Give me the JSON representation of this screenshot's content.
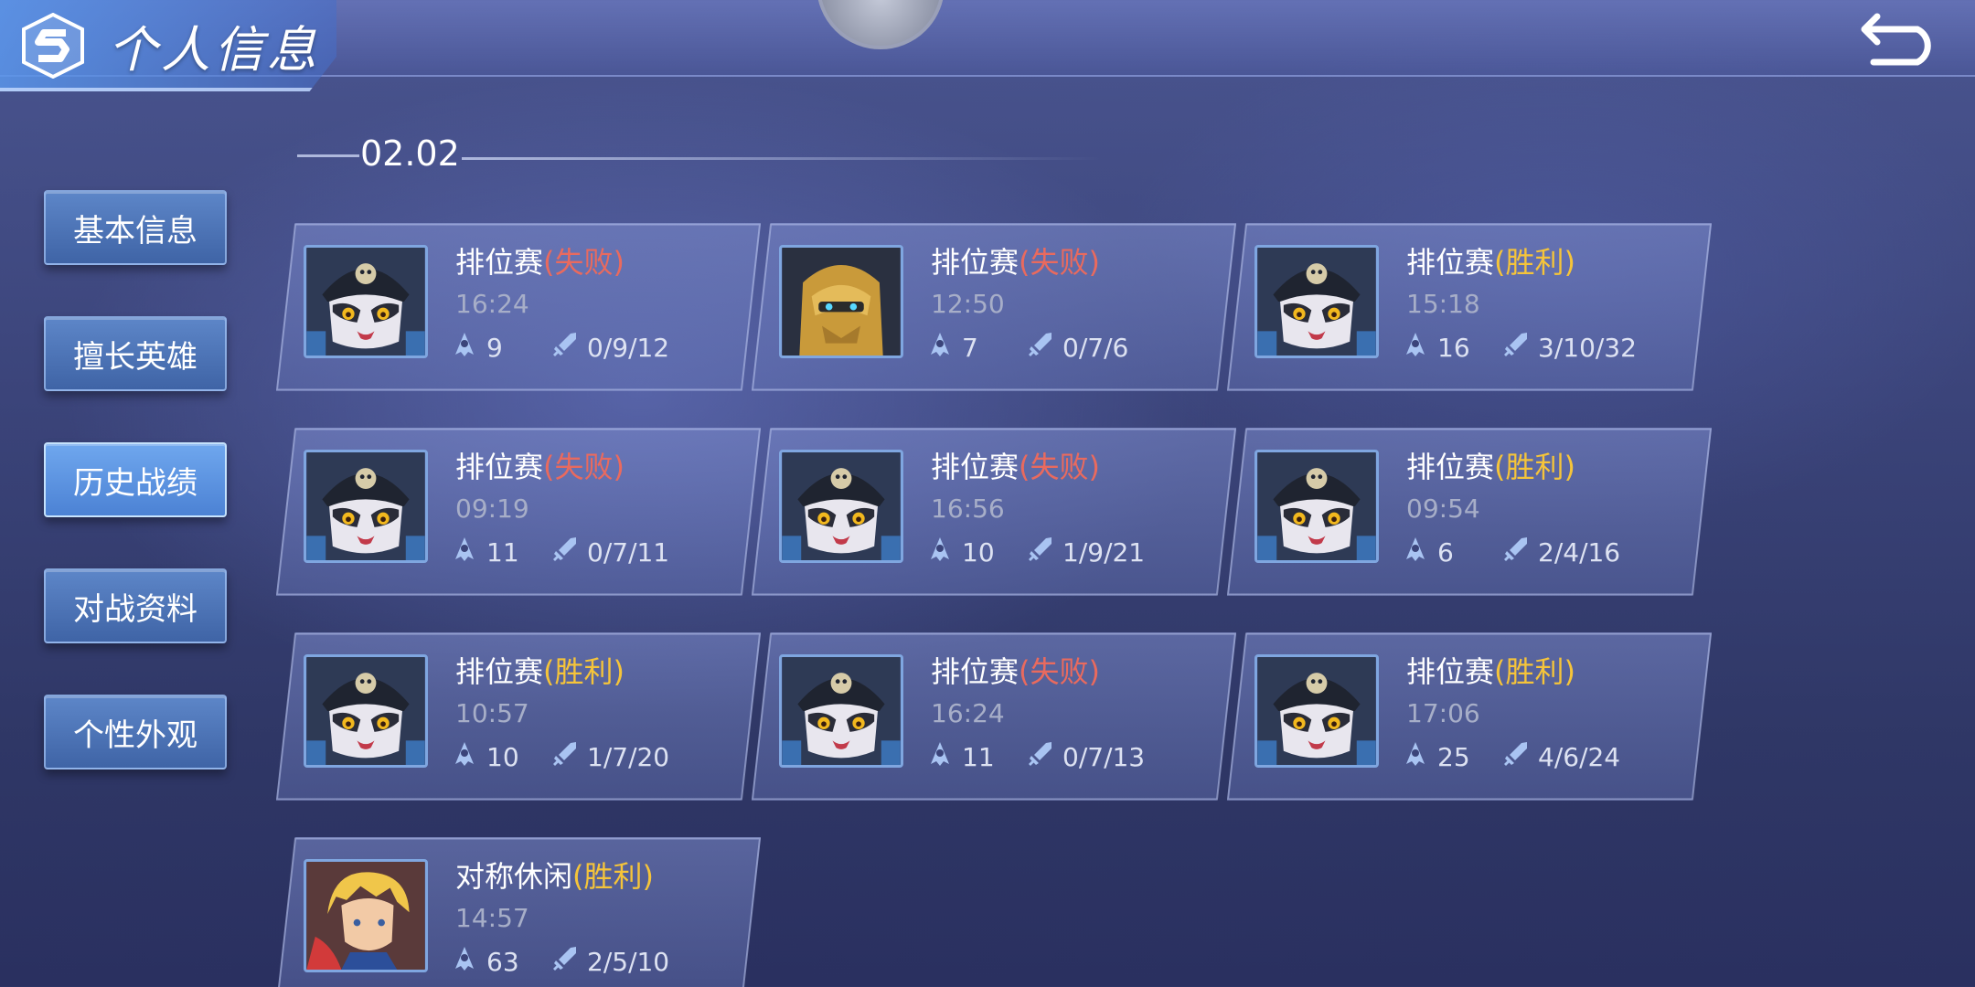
{
  "header": {
    "title": "个人信息"
  },
  "sidebar": {
    "items": [
      {
        "label": "基本信息"
      },
      {
        "label": "擅长英雄"
      },
      {
        "label": "历史战绩"
      },
      {
        "label": "对战资料"
      },
      {
        "label": "个性外观"
      }
    ],
    "active_index": 2
  },
  "history": {
    "date": "02.02",
    "matches": [
      {
        "hero": "cat-skull-hat",
        "mode": "排位赛",
        "result": "(失败)",
        "outcome": "lose",
        "time": "16:24",
        "score": "9",
        "kda": "0/9/12"
      },
      {
        "hero": "gold-mech",
        "mode": "排位赛",
        "result": "(失败)",
        "outcome": "lose",
        "time": "12:50",
        "score": "7",
        "kda": "0/7/6"
      },
      {
        "hero": "cat-skull-hat",
        "mode": "排位赛",
        "result": "(胜利)",
        "outcome": "win",
        "time": "15:18",
        "score": "16",
        "kda": "3/10/32"
      },
      {
        "hero": "cat-skull-hat",
        "mode": "排位赛",
        "result": "(失败)",
        "outcome": "lose",
        "time": "09:19",
        "score": "11",
        "kda": "0/7/11"
      },
      {
        "hero": "cat-skull-hat",
        "mode": "排位赛",
        "result": "(失败)",
        "outcome": "lose",
        "time": "16:56",
        "score": "10",
        "kda": "1/9/21"
      },
      {
        "hero": "cat-skull-hat",
        "mode": "排位赛",
        "result": "(胜利)",
        "outcome": "win",
        "time": "09:54",
        "score": "6",
        "kda": "2/4/16"
      },
      {
        "hero": "cat-skull-hat",
        "mode": "排位赛",
        "result": "(胜利)",
        "outcome": "win",
        "time": "10:57",
        "score": "10",
        "kda": "1/7/20"
      },
      {
        "hero": "cat-skull-hat",
        "mode": "排位赛",
        "result": "(失败)",
        "outcome": "lose",
        "time": "16:24",
        "score": "11",
        "kda": "0/7/13"
      },
      {
        "hero": "cat-skull-hat",
        "mode": "排位赛",
        "result": "(胜利)",
        "outcome": "win",
        "time": "17:06",
        "score": "25",
        "kda": "4/6/24"
      },
      {
        "hero": "blond-fighter",
        "mode": "对称休闲",
        "result": "(胜利)",
        "outcome": "win",
        "time": "14:57",
        "score": "63",
        "kda": "2/5/10"
      }
    ]
  },
  "colors": {
    "win": "#f5c43a",
    "lose": "#e96a5e",
    "accent": "#5d86c8"
  },
  "icons": {
    "score": "hooded-figure-icon",
    "kda": "sword-icon",
    "back": "back-arrow-icon",
    "logo": "s-logo-icon"
  }
}
